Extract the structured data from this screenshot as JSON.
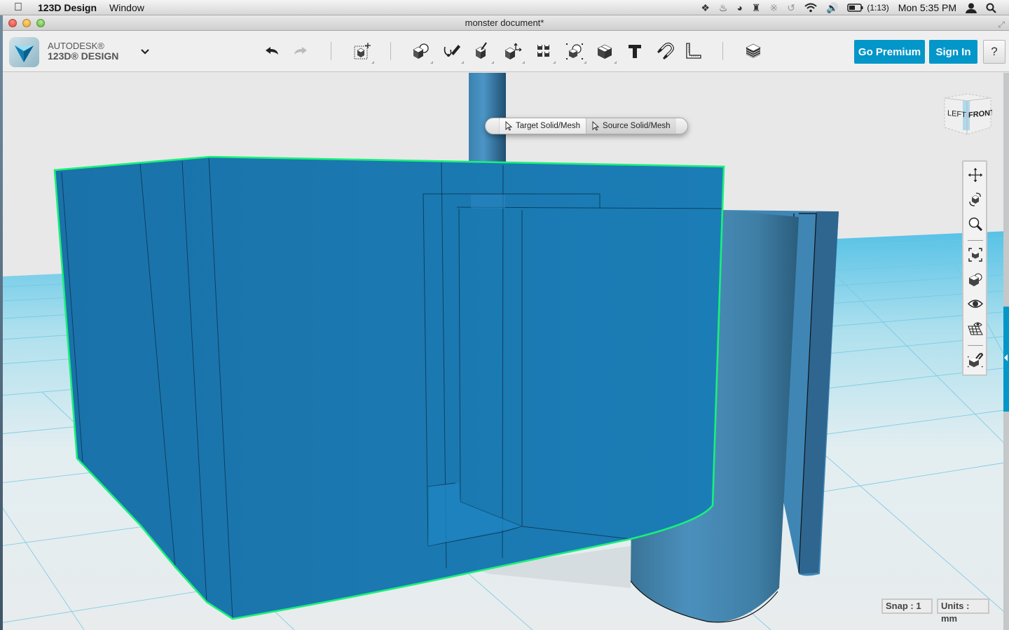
{
  "menubar": {
    "apple_icon": "apple-logo",
    "app_name": "123D Design",
    "menus": [
      "Window"
    ],
    "status_icons": [
      "dropbox-icon",
      "flame-icon",
      "power-knob-icon",
      "tower-icon",
      "bluetooth-icon",
      "time-machine-icon",
      "wifi-icon",
      "volume-icon",
      "battery-icon"
    ],
    "battery_time": "(1:13)",
    "clock": "Mon 5:35 PM",
    "user_icon": "user-icon",
    "spotlight_icon": "search-icon"
  },
  "window": {
    "title": "monster document*"
  },
  "toolbar": {
    "brand_line1": "AUTODESK®",
    "brand_line2": "123D® DESIGN",
    "menu_chevron": "⌄",
    "tools": [
      {
        "name": "undo",
        "icon": "undo-icon"
      },
      {
        "name": "redo",
        "icon": "redo-icon"
      },
      {
        "name": "transform",
        "icon": "transform-icon"
      },
      {
        "name": "primitives",
        "icon": "primitives-icon"
      },
      {
        "name": "sketch",
        "icon": "sketch-icon"
      },
      {
        "name": "construct",
        "icon": "construct-icon"
      },
      {
        "name": "modify",
        "icon": "modify-icon"
      },
      {
        "name": "pattern",
        "icon": "pattern-icon"
      },
      {
        "name": "grouping",
        "icon": "grouping-icon"
      },
      {
        "name": "combine",
        "icon": "combine-icon"
      },
      {
        "name": "text",
        "icon": "text-icon"
      },
      {
        "name": "snap",
        "icon": "snap-icon"
      },
      {
        "name": "measure",
        "icon": "measure-icon"
      },
      {
        "name": "materials",
        "icon": "materials-icon"
      }
    ],
    "go_premium": "Go Premium",
    "sign_in": "Sign In",
    "help": "?"
  },
  "context_pill": {
    "target_label": "Target Solid/Mesh",
    "source_label": "Source Solid/Mesh"
  },
  "view_cube": {
    "left_label": "LEFT",
    "front_label": "FRONT"
  },
  "nav_bar": {
    "items": [
      "pan-icon",
      "orbit-icon",
      "zoom-icon",
      "fit-icon",
      "views-icon",
      "visibility-icon",
      "grid-visibility-icon",
      "snap-material-icon"
    ]
  },
  "status": {
    "snap": "Snap : 1",
    "units": "Units : mm"
  },
  "colors": {
    "accent": "#0396c8",
    "model_blue": "#1b78b0",
    "selection_green": "#19f07a",
    "grid_line": "#5cc0e2",
    "viewport_bg": "#e8e8e8"
  }
}
